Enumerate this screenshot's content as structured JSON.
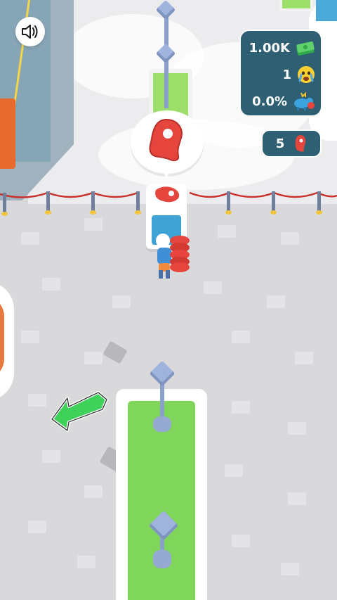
{
  "hud": {
    "money": "1.00K",
    "angry_customers": "1",
    "progress_percent": "0.0%",
    "steak_count": "5"
  },
  "icons": {
    "sound": "speaker-icon",
    "money": "cash-stack-icon",
    "angry": "crying-face-icon",
    "progress": "blue-cow-icon",
    "steak": "steak-icon",
    "direction": "green-arrow-icon"
  },
  "colors": {
    "panel": "#2f5f72",
    "steak_red": "#e5453c",
    "arrow_green": "#3fd25a",
    "grass": "#7fd65b"
  }
}
